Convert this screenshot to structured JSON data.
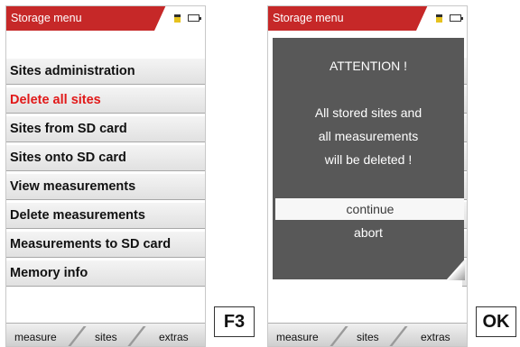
{
  "left_screen": {
    "header": {
      "title": "Storage menu"
    },
    "menu_items": [
      {
        "label": "Sites administration",
        "selected": false
      },
      {
        "label": "Delete all sites",
        "selected": true
      },
      {
        "label": "Sites from SD card",
        "selected": false
      },
      {
        "label": "Sites onto SD card",
        "selected": false
      },
      {
        "label": "View measurements",
        "selected": false
      },
      {
        "label": "Delete measurements",
        "selected": false
      },
      {
        "label": "Measurements to SD card",
        "selected": false
      },
      {
        "label": "Memory info",
        "selected": false
      }
    ],
    "softkeys": [
      "measure",
      "sites",
      "extras"
    ]
  },
  "right_screen": {
    "header": {
      "title": "Storage menu"
    },
    "dialog": {
      "title": "ATTENTION !",
      "message": [
        "All stored sites and",
        "all measurements",
        "will be deleted !"
      ],
      "options": [
        {
          "label": "continue",
          "selected": true
        },
        {
          "label": "abort",
          "selected": false
        }
      ]
    },
    "softkeys": [
      "measure",
      "sites",
      "extras"
    ]
  },
  "keys": {
    "left": "F3",
    "right": "OK"
  },
  "colors": {
    "accent": "#c62828",
    "selected_text": "#e11919",
    "dialog_bg": "#585858",
    "sd_card": "#e6c21f"
  },
  "icons": {
    "sd_card": "sd-card-icon",
    "battery": "battery-icon"
  }
}
